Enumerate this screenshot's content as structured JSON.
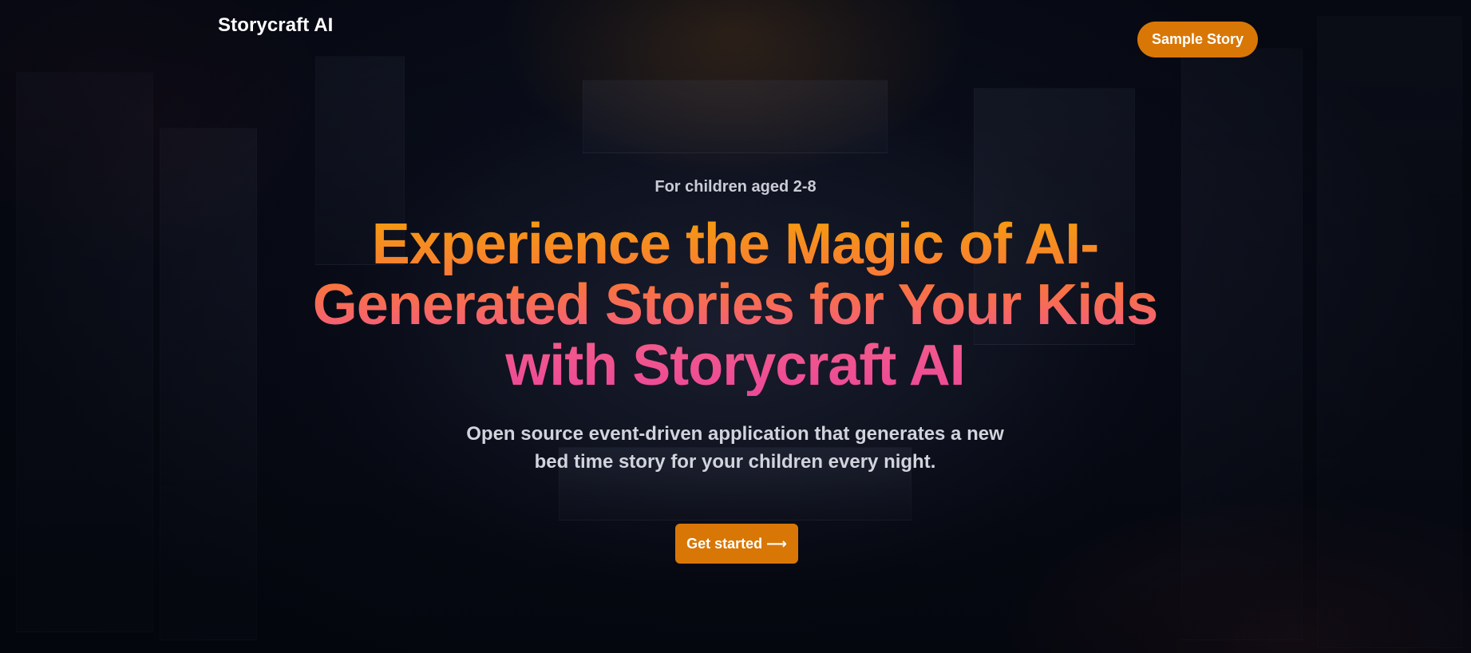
{
  "header": {
    "brand": "Storycraft AI",
    "sample_button": "Sample Story"
  },
  "hero": {
    "eyebrow": "For children aged 2-8",
    "headline_lines": [
      "Experience the Magic of AI-",
      "Generated Stories for Your Kids",
      "with Storycraft AI"
    ],
    "subtitle_lines": [
      "Open source event-driven application that generates a new",
      "bed time story for your children every night."
    ],
    "cta_label": "Get started ⟶"
  },
  "colors": {
    "accent": "#d97706",
    "gradient_start": "#f59e0b",
    "gradient_end": "#ec4899",
    "background": "#070a14"
  }
}
